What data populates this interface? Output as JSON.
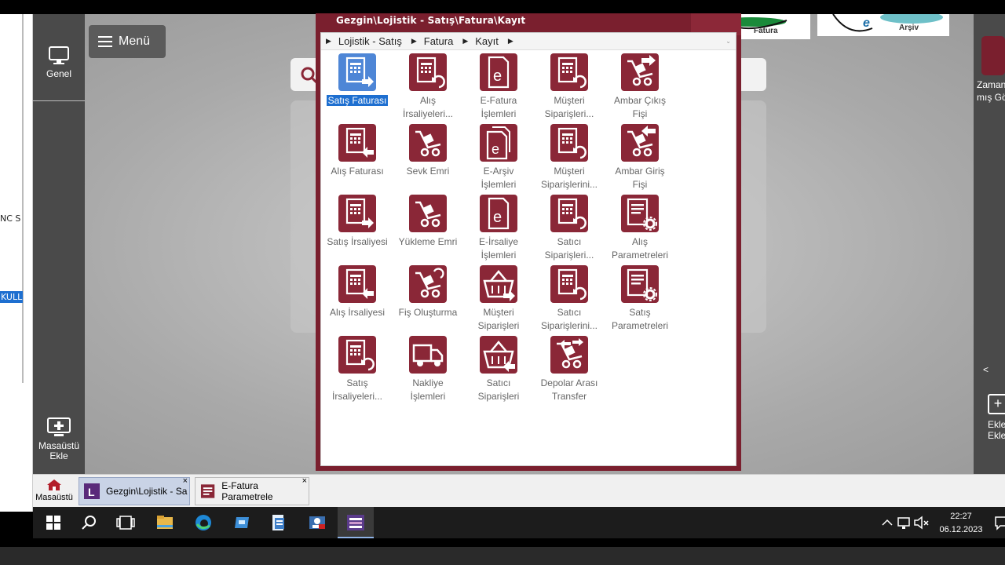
{
  "window": {
    "title": "Gezgin\\Lojistik - Satış\\Fatura\\Kayıt",
    "breadcrumb": [
      "Lojistik - Satış",
      "Fatura",
      "Kayıt"
    ]
  },
  "desktop": {
    "menu_label": "Menü",
    "left_items": {
      "genel": "Genel",
      "add_line1": "Masaüstü",
      "add_line2": "Ekle"
    },
    "right_items": {
      "label1": "Zaman",
      "label2": "mış Gö",
      "add1": "Ekle",
      "add2": "Ekle"
    },
    "left_fragments": [
      "NC S",
      "KULL"
    ],
    "logos": {
      "efatura": "Fatura",
      "earsiv": "Arşiv"
    }
  },
  "tiles": [
    {
      "line1": "Satış Faturası",
      "line2": "",
      "icon": "invoice-out-icon",
      "selected": true
    },
    {
      "line1": "Alış",
      "line2": "İrsaliyeleri...",
      "icon": "invoice-refresh-icon"
    },
    {
      "line1": "E-Fatura",
      "line2": "İşlemleri",
      "icon": "e-document-icon"
    },
    {
      "line1": "Müşteri",
      "line2": "Siparişleri...",
      "icon": "invoice-refresh-icon"
    },
    {
      "line1": "Ambar Çıkış",
      "line2": "Fişi",
      "icon": "handtruck-out-icon"
    },
    {
      "line1": "Alış Faturası",
      "line2": "",
      "icon": "invoice-in-icon"
    },
    {
      "line1": "Sevk Emri",
      "line2": "",
      "icon": "handtruck-icon"
    },
    {
      "line1": "E-Arşiv",
      "line2": "İşlemleri",
      "icon": "e-archive-icon"
    },
    {
      "line1": "Müşteri",
      "line2": "Siparişlerini...",
      "icon": "invoice-refresh-icon"
    },
    {
      "line1": "Ambar Giriş",
      "line2": "Fişi",
      "icon": "handtruck-in-icon"
    },
    {
      "line1": "Satış İrsaliyesi",
      "line2": "",
      "icon": "invoice-out-icon"
    },
    {
      "line1": "Yükleme Emri",
      "line2": "",
      "icon": "handtruck-icon"
    },
    {
      "line1": "E-İrsaliye",
      "line2": "İşlemleri",
      "icon": "e-document-icon"
    },
    {
      "line1": "Satıcı",
      "line2": "Siparişleri...",
      "icon": "invoice-refresh-icon"
    },
    {
      "line1": "Alış",
      "line2": "Parametreleri",
      "icon": "settings-doc-icon"
    },
    {
      "line1": "Alış İrsaliyesi",
      "line2": "",
      "icon": "invoice-in-icon"
    },
    {
      "line1": "Fiş Oluşturma",
      "line2": "",
      "icon": "handtruck-refresh-icon"
    },
    {
      "line1": "Müşteri",
      "line2": "Siparişleri",
      "icon": "basket-out-icon"
    },
    {
      "line1": "Satıcı",
      "line2": "Siparişlerini...",
      "icon": "invoice-refresh-icon"
    },
    {
      "line1": "Satış",
      "line2": "Parametreleri",
      "icon": "settings-doc-icon"
    },
    {
      "line1": "Satış",
      "line2": "İrsaliyeleri...",
      "icon": "invoice-refresh-icon"
    },
    {
      "line1": "Nakliye",
      "line2": "İşlemleri",
      "icon": "truck-icon"
    },
    {
      "line1": "Satıcı",
      "line2": "Siparişleri",
      "icon": "basket-in-icon"
    },
    {
      "line1": "Depolar Arası",
      "line2": "Transfer",
      "icon": "handtruck-transfer-icon"
    }
  ],
  "app_taskbar": {
    "home_label": "Masaüstü",
    "windows": [
      {
        "label": "Gezgin\\Lojistik - Sa",
        "active": true
      },
      {
        "label": "E-Fatura Parametrele",
        "active": false
      }
    ],
    "close_glyph": "×"
  },
  "system": {
    "time": "22:27",
    "date": "06.12.2023"
  },
  "colors": {
    "brand": "#7a1f2e",
    "selection": "#1e6fd0"
  }
}
